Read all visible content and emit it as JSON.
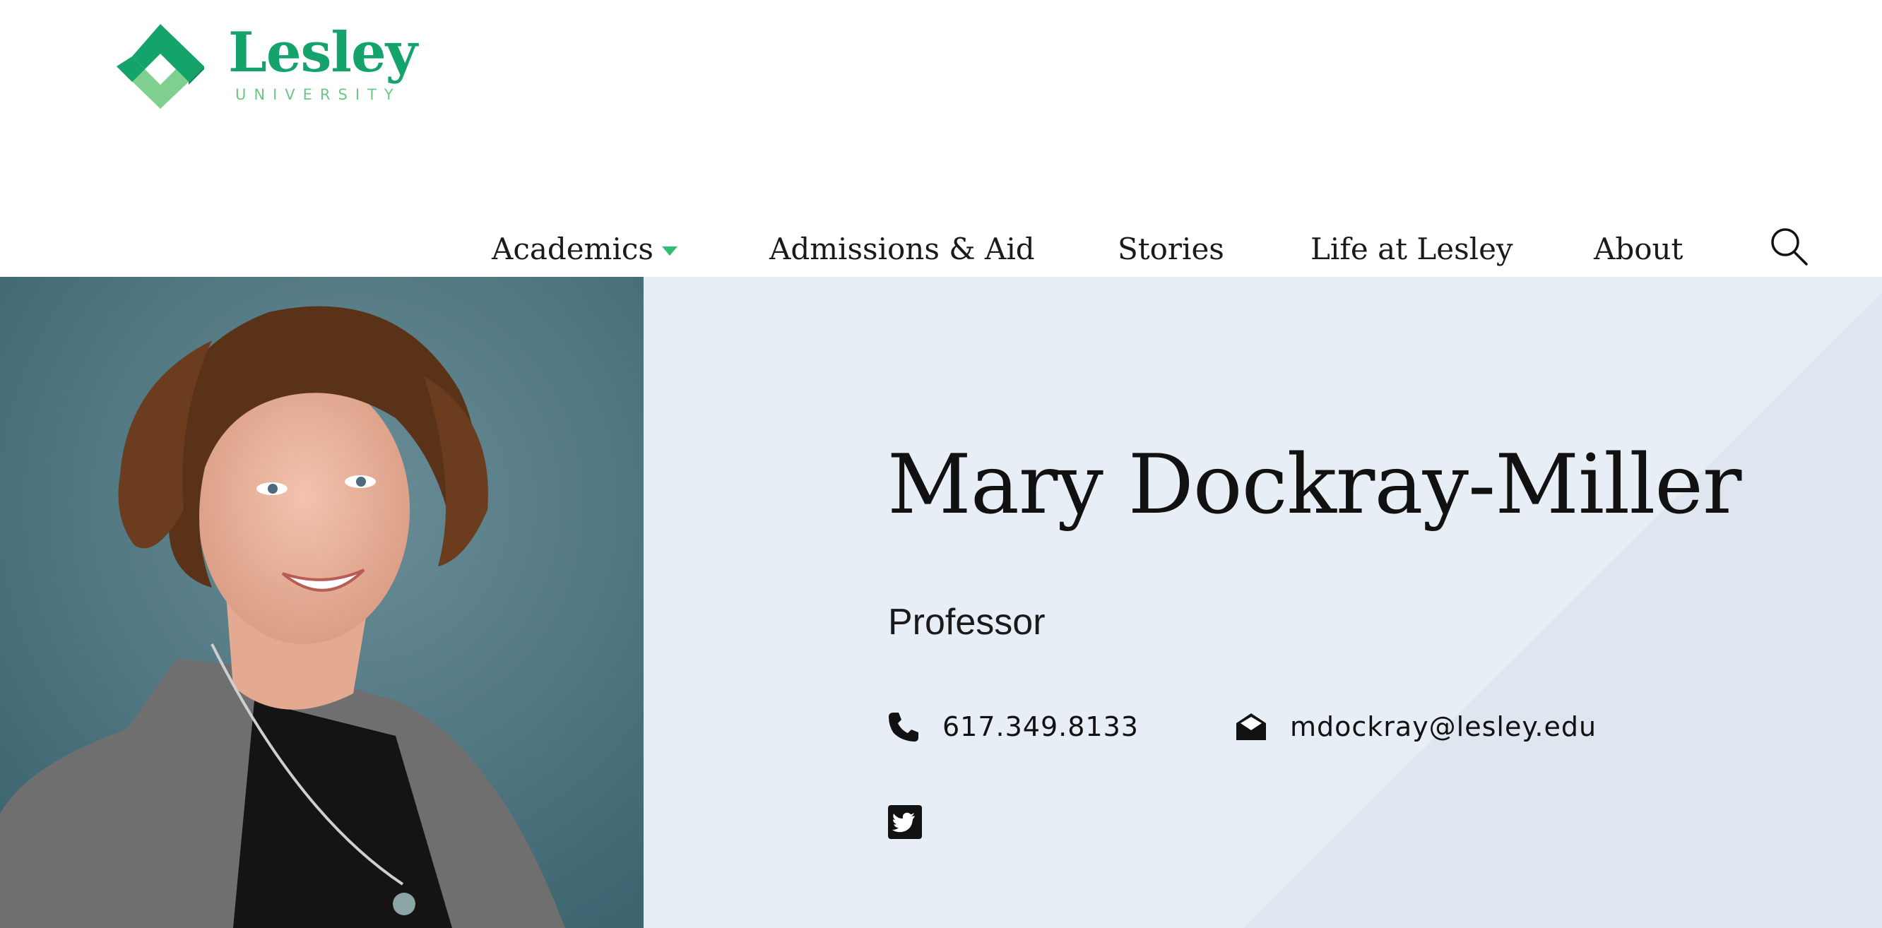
{
  "brand": {
    "name": "Lesley",
    "subtitle": "UNIVERSITY",
    "primary_color": "#14a36a",
    "light_color": "#6cc785"
  },
  "nav": {
    "items": [
      {
        "label": "Academics",
        "has_dropdown": true
      },
      {
        "label": "Admissions & Aid"
      },
      {
        "label": "Stories"
      },
      {
        "label": "Life at Lesley"
      },
      {
        "label": "About"
      }
    ],
    "search_icon": "search-icon",
    "caret_color": "#2fbf71"
  },
  "profile": {
    "name": "Mary Dockray-Miller",
    "title": "Professor",
    "phone": "617.349.8133",
    "email": "mdockray@lesley.edu",
    "photo_icon": "portrait-photo",
    "phone_icon": "phone-icon",
    "email_icon": "envelope-icon",
    "social_icon": "twitter-icon",
    "background_color": "#e8eef5"
  }
}
